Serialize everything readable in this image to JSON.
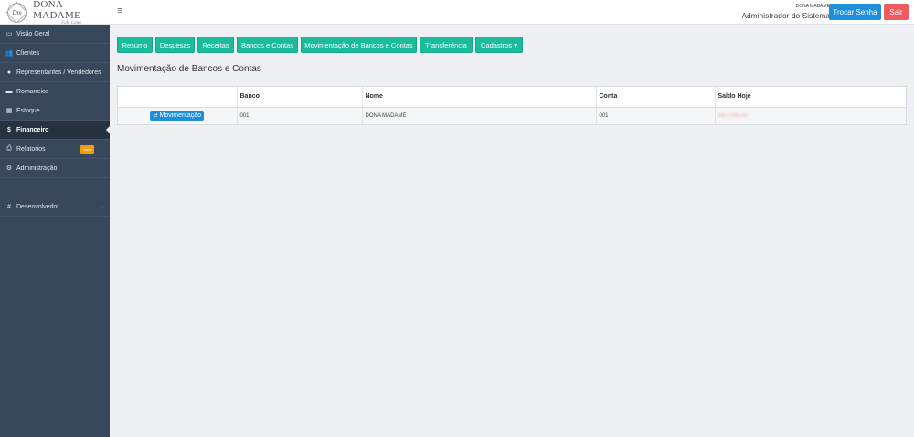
{
  "header": {
    "logo_mark": "Dm",
    "logo_title": "DONA MADAME",
    "logo_sub": "Fab. Caitá",
    "menu_icon": "hamburger-icon",
    "company": "DONA MADAME",
    "user_role": "Administrador do Sistema",
    "btn_change_password": "Trocar Senha",
    "btn_logout": "Sair"
  },
  "sidebar": {
    "items": [
      {
        "label": "Visão Geral",
        "icon": "monitor-icon"
      },
      {
        "label": "Clientes",
        "icon": "users-icon"
      },
      {
        "label": "Representantes / Vendedores",
        "icon": "user-tie-icon"
      },
      {
        "label": "Romaneios",
        "icon": "truck-icon"
      },
      {
        "label": "Estoque",
        "icon": "grid-icon"
      },
      {
        "label": "Financeiro",
        "icon": "dollar-icon",
        "active": true
      },
      {
        "label": "Relatorios",
        "icon": "printer-icon",
        "badge": "Novo"
      },
      {
        "label": "Administração",
        "icon": "gear-icon"
      },
      {
        "label": "Desenvolvedor",
        "icon": "hash-icon"
      }
    ]
  },
  "tabs": [
    {
      "label": "Resumo"
    },
    {
      "label": "Despesas"
    },
    {
      "label": "Receitas"
    },
    {
      "label": "Bancos e Contas"
    },
    {
      "label": "Movimentação de Bancos e Contas"
    },
    {
      "label": "Transferência"
    },
    {
      "label": "Cadastros ▾"
    }
  ],
  "page": {
    "title": "Movimentação de Bancos e Contas"
  },
  "table": {
    "columns": [
      "",
      "Banco",
      "Nome",
      "Conta",
      "Saldo Hoje"
    ],
    "rows": [
      {
        "action": "Movimentação",
        "banco": "001",
        "nome": "DONA MADAME",
        "conta": "001",
        "saldo": "R$ 1.000,00"
      }
    ]
  },
  "colors": {
    "sidebar_bg": "#38485a",
    "tab_green": "#1abc9c",
    "primary_blue": "#1f8fdb",
    "danger_red": "#ee5a5f",
    "badge_orange": "#f39c12"
  }
}
